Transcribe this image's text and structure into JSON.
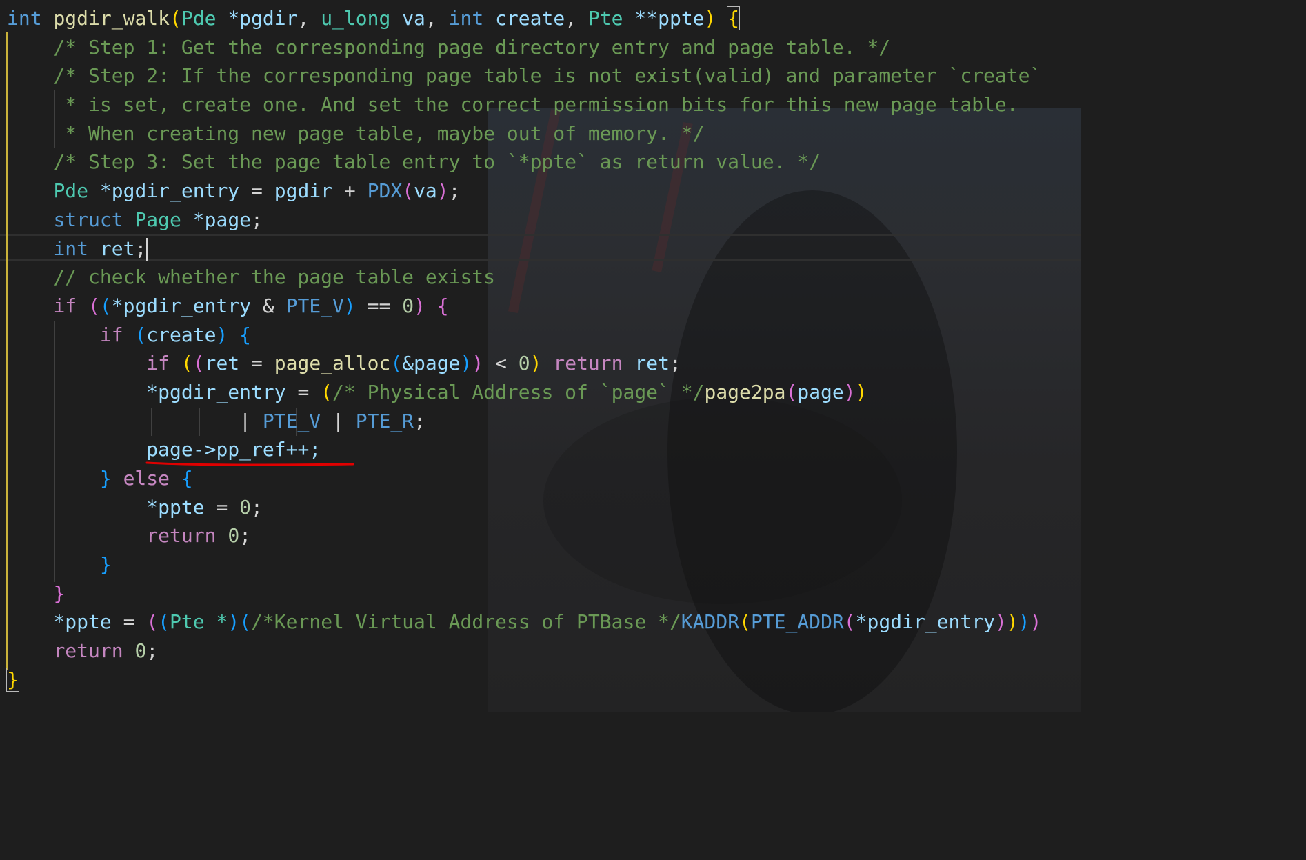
{
  "editor": {
    "theme_colors": {
      "background": "#1e1e1e",
      "keyword": "#569cd6",
      "control": "#c586c0",
      "type": "#4ec9b0",
      "function": "#dcdcaa",
      "variable": "#9cdcfe",
      "number": "#b5cea8",
      "comment": "#6a9955",
      "bracket_level1": "#ffd700",
      "bracket_level2": "#da70d6",
      "bracket_level3": "#179fff",
      "annotation": "#e00000"
    },
    "cursor_line": 9,
    "annotation": "red-underline under page->pp_ref++;"
  },
  "code": {
    "t_int": "int",
    "t_fn_name": "pgdir_walk",
    "t_lp": "(",
    "t_pde": "Pde",
    "t_star_pgdir": "*pgdir",
    "t_comma": ",",
    "t_ulong": "u_long",
    "t_va": "va",
    "t_create": "create",
    "t_pte": "Pte",
    "t_dstar_ppte": "**ppte",
    "t_rp": ")",
    "t_lbrace": "{",
    "t_rbrace": "}",
    "c_step1": "/* Step 1: Get the corresponding page directory entry and page table. */",
    "c_step2": "/* Step 2: If the corresponding page table is not exist(valid) and parameter `create`",
    "c_step2b": "* is set, create one. And set the correct permission bits for this new page table.",
    "c_step2c": "* When creating new page table, maybe out of memory. */",
    "c_step3": "/* Step 3: Set the page table entry to `*ppte` as return value. */",
    "t_star_pgdir_entry": "*pgdir_entry",
    "t_eq": "=",
    "t_pgdir": "pgdir",
    "t_plus": "+",
    "t_PDX": "PDX",
    "t_semi": ";",
    "t_struct": "struct",
    "t_Page": "Page",
    "t_star_page": "*page",
    "t_ret": "ret",
    "c_check": "// check whether the page table exists",
    "t_if": "if",
    "t_amp": "&",
    "t_PTE_V": "PTE_V",
    "t_eqeq": "==",
    "t_zero": "0",
    "t_create_plain": "create",
    "t_page_alloc": "page_alloc",
    "t_amp_page": "&page",
    "t_lt": "<",
    "t_return": "return",
    "c_phys": "/* Physical Address of `page` */",
    "t_page2pa": "page2pa",
    "t_page": "page",
    "t_pipe": "|",
    "t_PTE_R": "PTE_R",
    "t_pp_ref": "page->pp_ref++;",
    "t_else": "else",
    "t_star_ppte": "*ppte",
    "t_Pte_star": "Pte *",
    "c_kva": "/*Kernel Virtual Address of PTBase */",
    "t_KADDR": "KADDR",
    "t_PTE_ADDR": "PTE_ADDR"
  }
}
